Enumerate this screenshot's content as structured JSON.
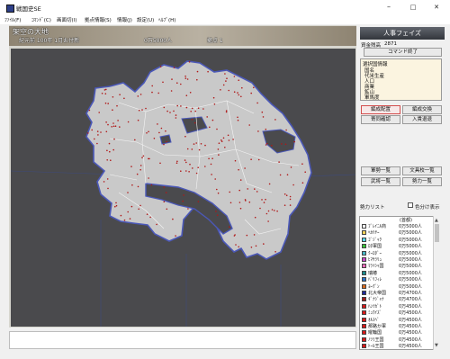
{
  "window": {
    "title": "戦国史SE",
    "minimize": "–",
    "maximize": "□",
    "close": "✕"
  },
  "menu": [
    {
      "label": "ﾌｧｲﾙ(F)"
    },
    {
      "label": "ｺﾏﾝﾄﾞ(C)"
    },
    {
      "label": "画面切(I)"
    },
    {
      "label": "拠点情報(S)"
    },
    {
      "label": "情報(J)"
    },
    {
      "label": "設定(U)"
    },
    {
      "label": "ﾍﾙﾌﾟ(H)"
    }
  ],
  "header": {
    "scenario": "架空の大地",
    "date": "紀元前 100年 1月お付新",
    "population": "0万5000人",
    "bases": "拠点 1"
  },
  "panel": {
    "phase": "人事フェイズ",
    "funds_label": "資金残高",
    "funds_value": "2871",
    "end_command": "コマンド終了",
    "info_title": "選択国情報",
    "info_lines": [
      "国名",
      "代米生産",
      "人口",
      "商業",
      "鉱山",
      "軍馬度"
    ],
    "buttons": {
      "hiring": "編成配置",
      "exchange": "編成交換",
      "recruit": "寄同確認",
      "enter": "入貴退退",
      "army_list": "軍勢一覧",
      "civil_list": "文具校一覧",
      "officer_list": "武将一覧",
      "power_list": "勢力一覧"
    },
    "list_title": "勢力リスト",
    "list_checkbox": "色分け表示",
    "list_header": "(首都)",
    "factions": [
      {
        "name": "ﾌﾞﾚｲﾆﾙ商",
        "pop": "0万5000人",
        "color": "#ffffff"
      },
      {
        "name": "ﾍｶﾘﾔｰ",
        "pop": "0万5000人",
        "color": "#f2d25a"
      },
      {
        "name": "ｺﾞｼﾞｬｸ",
        "pop": "0万5000人",
        "color": "#58d8e8"
      },
      {
        "name": "ﾛﾀ軍国",
        "pop": "0万5000人",
        "color": "#3cc43c"
      },
      {
        "name": "ｸｰﾛﾀﾞｰ",
        "pop": "0万5000人",
        "color": "#49b8c8"
      },
      {
        "name": "ﾋﾏｻﾗﾘｭ",
        "pop": "0万5000人",
        "color": "#c848c8"
      },
      {
        "name": "ﾏﾗｲｼｬ国",
        "pop": "0万5000人",
        "color": "#e868b8"
      },
      {
        "name": "瑞椿",
        "pop": "0万5000人",
        "color": "#1d8d8d"
      },
      {
        "name": "ﾊﾞﾘﾌｨﾚ",
        "pop": "0万5000人",
        "color": "#2a72c8"
      },
      {
        "name": "ﾖｰｸﾞﾝ",
        "pop": "0万5000人",
        "color": "#d86a1e"
      },
      {
        "name": "北大帝国",
        "pop": "0万4700人",
        "color": "#202a9a"
      },
      {
        "name": "ｷﾞﾅｼﾞｬﾅ",
        "pop": "0万4700人",
        "color": "#a01a1a"
      },
      {
        "name": "ﾊﾝﾂｶﾞﾄ",
        "pop": "0万4500人",
        "color": "#d81818"
      },
      {
        "name": "ﾐｭｳｲｽﾞ",
        "pop": "0万4500人",
        "color": "#d81818"
      },
      {
        "name": "ｵﾙｽﾍﾞ",
        "pop": "0万4500人",
        "color": "#d81818"
      },
      {
        "name": "那路か軍",
        "pop": "0万4500人",
        "color": "#d81818"
      },
      {
        "name": "曜輪国",
        "pop": "0万4500人",
        "color": "#d81818"
      },
      {
        "name": "ﾉﾂﾗ王国",
        "pop": "0万4500人",
        "color": "#d81818"
      },
      {
        "name": "ﾄｰﾙ王国",
        "pop": "0万4500人",
        "color": "#d81818"
      }
    ]
  }
}
